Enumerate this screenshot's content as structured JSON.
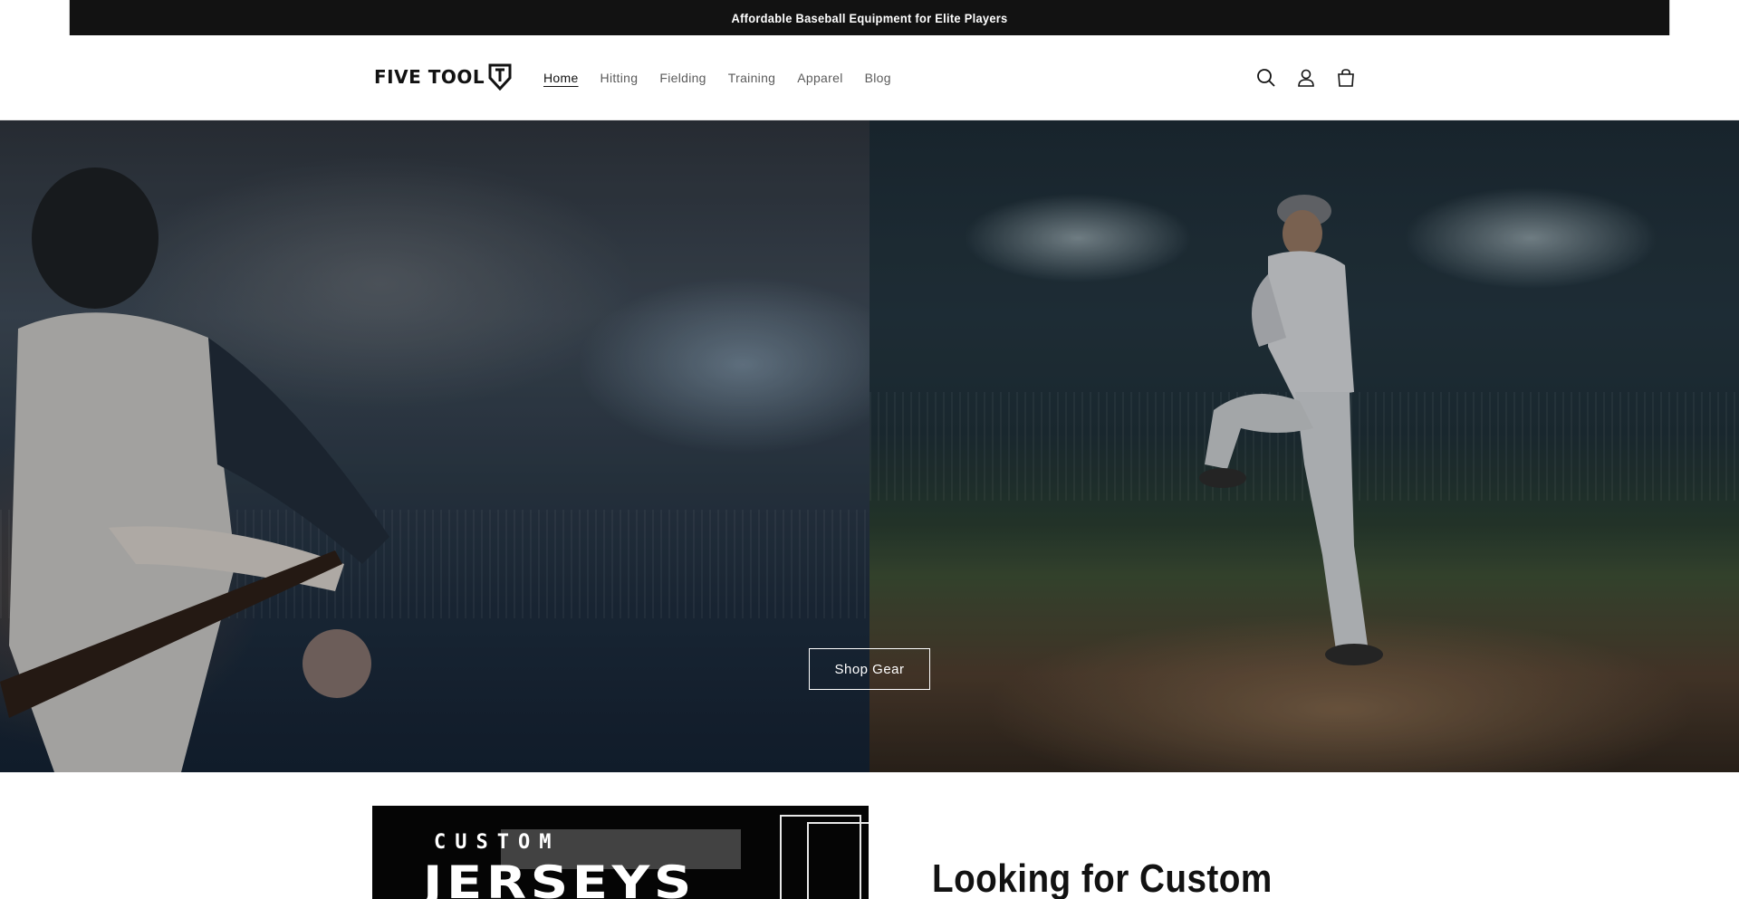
{
  "announcement": {
    "text": "Affordable Baseball Equipment for Elite Players"
  },
  "header": {
    "logo_text": "FIVE TOOL",
    "nav": [
      {
        "label": "Home",
        "active": true
      },
      {
        "label": "Hitting",
        "active": false
      },
      {
        "label": "Fielding",
        "active": false
      },
      {
        "label": "Training",
        "active": false
      },
      {
        "label": "Apparel",
        "active": false
      },
      {
        "label": "Blog",
        "active": false
      }
    ],
    "icons": [
      "search-icon",
      "account-icon",
      "cart-icon"
    ]
  },
  "hero": {
    "button_label": "Shop Gear"
  },
  "feature": {
    "image_text_small": "CUSTOM",
    "image_text_large": "JERSEYS",
    "heading": "Looking for Custom"
  },
  "colors": {
    "announcement_bg": "#121212",
    "text": "#121212",
    "nav_inactive": "#5b5b5b",
    "background": "#ffffff"
  }
}
